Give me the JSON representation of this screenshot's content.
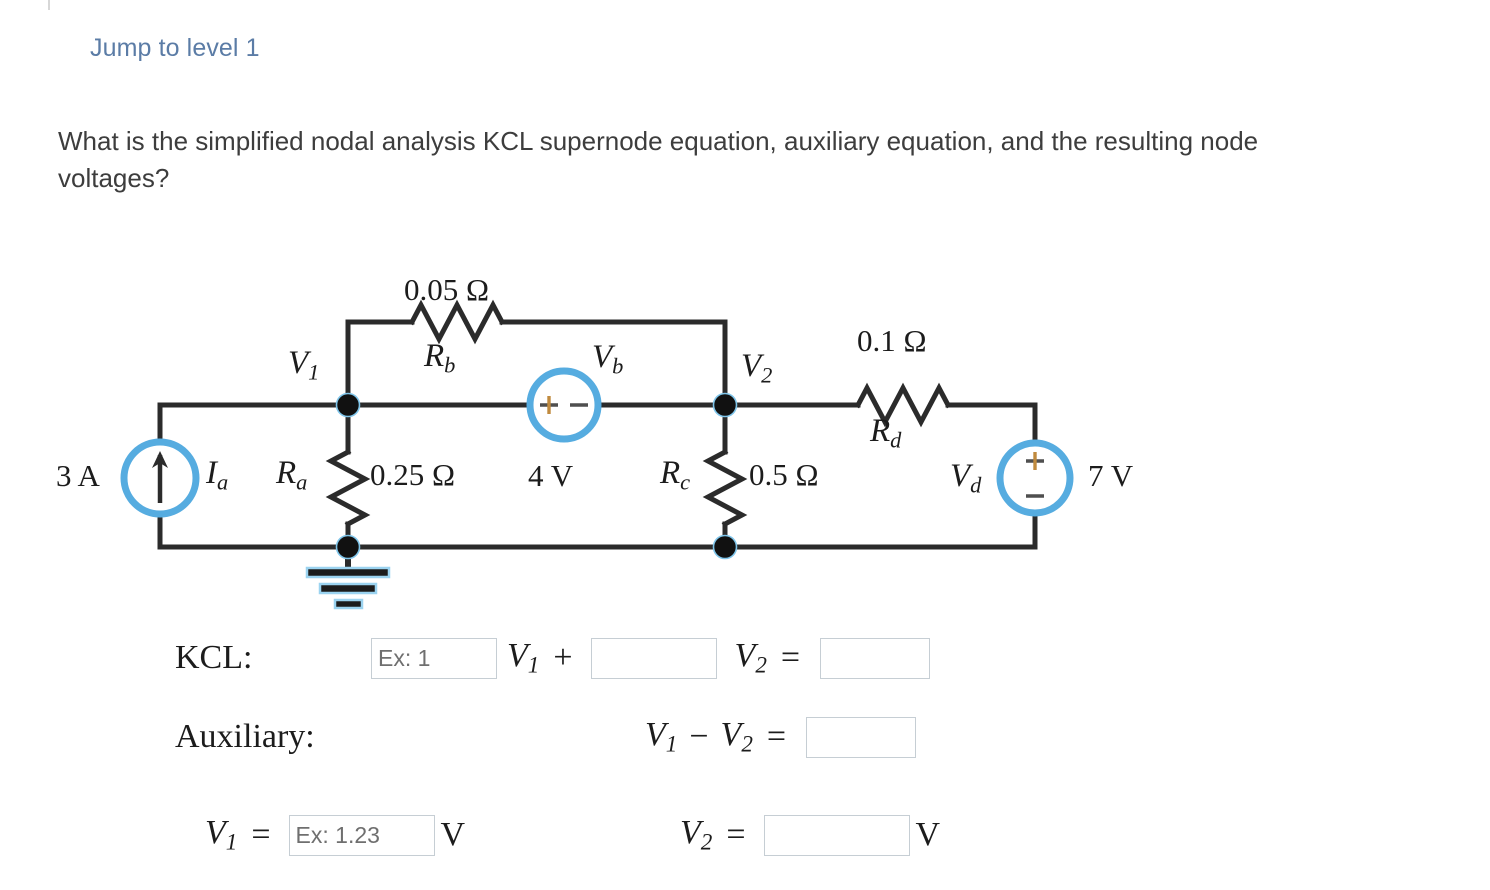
{
  "header": {
    "jump_link": "Jump to level 1"
  },
  "question": {
    "text": "What is the simplified nodal analysis KCL supernode equation, auxiliary equation, and the resulting node voltages?"
  },
  "circuit": {
    "title": "supernode-circuit",
    "accent_color": "#56ace0",
    "wire_color": "#2b2b2b",
    "label_color": "#1c1c1c",
    "current_source": {
      "name": "Ia",
      "symbol": "I",
      "subscript": "a",
      "value": "3 A",
      "direction": "up"
    },
    "resistors": [
      {
        "name": "Ra",
        "symbol": "R",
        "subscript": "a",
        "value": "0.25 Ω",
        "orientation": "vertical"
      },
      {
        "name": "Rb",
        "symbol": "R",
        "subscript": "b",
        "value": "0.05 Ω",
        "orientation": "horizontal"
      },
      {
        "name": "Rc",
        "symbol": "R",
        "subscript": "c",
        "value": "0.5 Ω",
        "orientation": "vertical"
      },
      {
        "name": "Rd",
        "symbol": "R",
        "subscript": "d",
        "value": "0.1 Ω",
        "orientation": "horizontal"
      }
    ],
    "voltage_sources": [
      {
        "name": "Vb",
        "symbol": "V",
        "subscript": "b",
        "value": "4 V",
        "polarity": "+ −",
        "orientation": "horizontal"
      },
      {
        "name": "Vd",
        "symbol": "V",
        "subscript": "d",
        "value": "7 V",
        "polarity": "+ over −",
        "orientation": "vertical"
      }
    ],
    "nodes": [
      {
        "name": "V1",
        "symbol": "V",
        "subscript": "1"
      },
      {
        "name": "V2",
        "symbol": "V",
        "subscript": "2"
      }
    ],
    "ground_label": "ground"
  },
  "answers": {
    "kcl": {
      "label": "KCL:",
      "coef1_placeholder": "Ex: 1",
      "coef1_value": "",
      "term1": "V",
      "term1_sub": "1",
      "plus": "+",
      "coef2_placeholder": "",
      "coef2_value": "",
      "term2": "V",
      "term2_sub": "2",
      "equals": "=",
      "rhs_placeholder": "",
      "rhs_value": ""
    },
    "auxiliary": {
      "label": "Auxiliary:",
      "expression_v1": "V",
      "expression_v1_sub": "1",
      "minus": "−",
      "expression_v2": "V",
      "expression_v2_sub": "2",
      "equals": "=",
      "value_placeholder": "",
      "value": ""
    },
    "v1_result": {
      "symbol": "V",
      "subscript": "1",
      "equals": "=",
      "placeholder": "Ex: 1.23",
      "value": "",
      "unit": "V"
    },
    "v2_result": {
      "symbol": "V",
      "subscript": "2",
      "equals": "=",
      "placeholder": "",
      "value": "",
      "unit": "V"
    }
  }
}
